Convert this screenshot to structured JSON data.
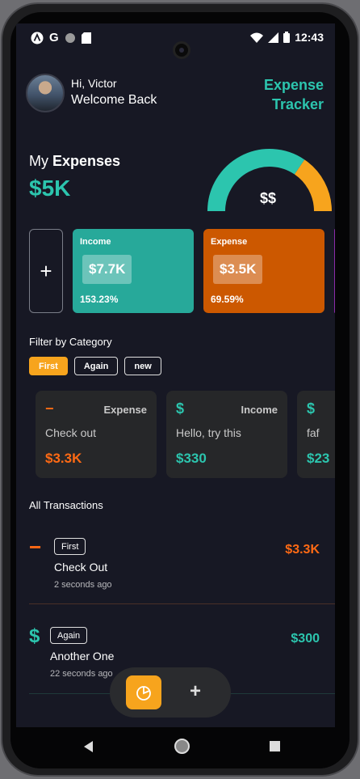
{
  "status_bar": {
    "time": "12:43",
    "icons": [
      "app-a-icon",
      "google-icon",
      "circle-icon",
      "sd-card-icon",
      "wifi-icon",
      "signal-icon",
      "battery-icon"
    ]
  },
  "header": {
    "greeting": "Hi, Victor",
    "welcome": "Welcome Back",
    "app_title": "Expense Tracker"
  },
  "summary": {
    "label_prefix": "My",
    "label_bold": "Expenses",
    "total": "$5K",
    "gauge_label": "$$",
    "gauge": {
      "income_fraction": 0.69,
      "income_color": "#2cc5ae",
      "expense_color": "#f7a41d"
    }
  },
  "cards": {
    "add_symbol": "+",
    "income": {
      "title": "Income",
      "value": "$7.7K",
      "percent": "153.23%"
    },
    "expense": {
      "title": "Expense",
      "value": "$3.5K",
      "percent": "69.59%"
    }
  },
  "filter": {
    "title": "Filter by Category",
    "chips": [
      {
        "label": "First",
        "active": true
      },
      {
        "label": "Again",
        "active": false
      },
      {
        "label": "new",
        "active": false
      }
    ]
  },
  "categories": [
    {
      "icon": "−",
      "kind": "Expense",
      "desc": "Check out",
      "amount": "$3.3K",
      "color": "#ff6a14"
    },
    {
      "icon": "$",
      "kind": "Income",
      "desc": "Hello, try this",
      "amount": "$330",
      "color": "#2cc5ae"
    },
    {
      "icon": "$",
      "kind": "",
      "desc": "faf",
      "amount": "$23",
      "color": "#2cc5ae"
    }
  ],
  "transactions": {
    "title": "All Transactions",
    "items": [
      {
        "icon": "−",
        "tag": "First",
        "title": "Check Out",
        "time": "2 seconds ago",
        "amount": "$3.3K",
        "color": "#ff6a14"
      },
      {
        "icon": "$",
        "tag": "Again",
        "title": "Another One",
        "time": "22 seconds ago",
        "amount": "$300",
        "color": "#2cc5ae"
      }
    ]
  },
  "bottom_nav": {
    "add_symbol": "+"
  }
}
